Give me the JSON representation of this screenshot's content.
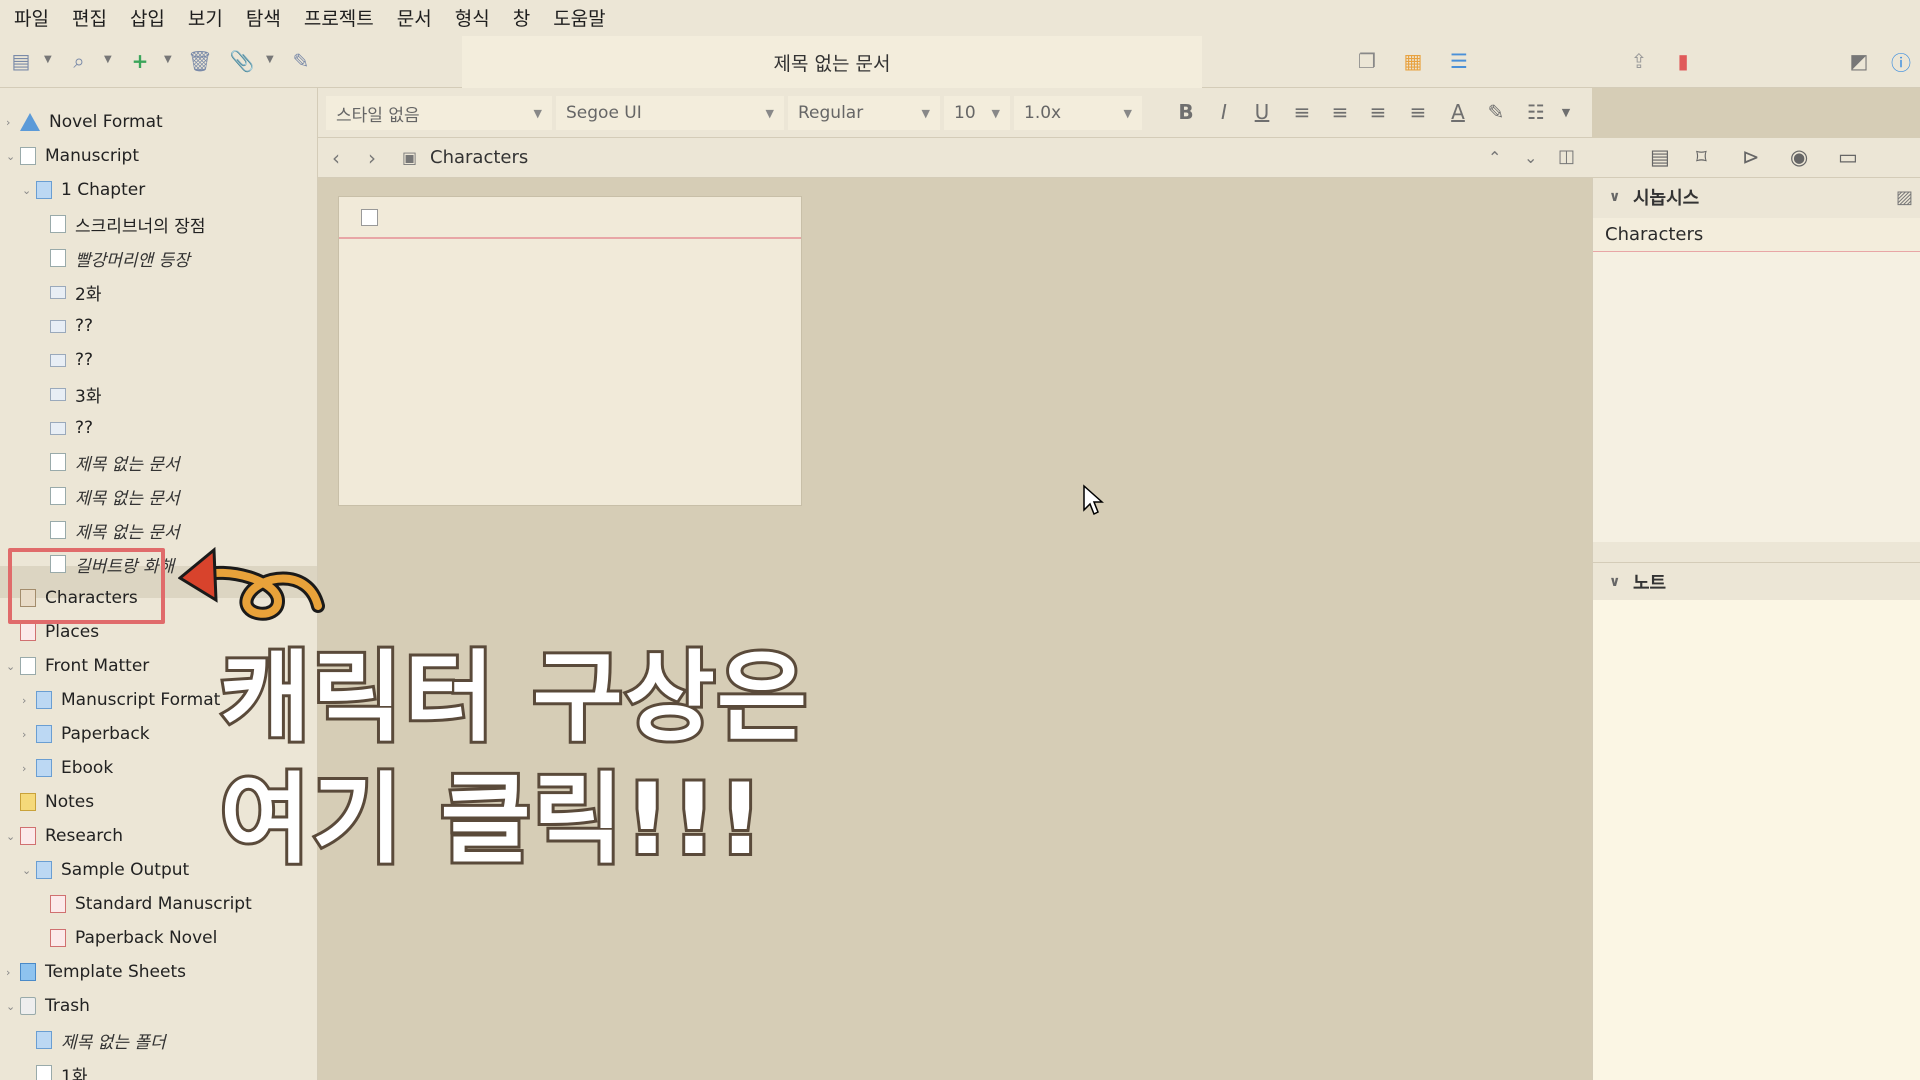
{
  "menu": [
    "파일",
    "편집",
    "삽입",
    "보기",
    "탐색",
    "프로젝트",
    "문서",
    "형식",
    "창",
    "도움말"
  ],
  "document_title": "제목 없는 문서",
  "binder": [
    {
      "label": "Novel Format",
      "icon": "warning-icon",
      "italic": false
    },
    {
      "label": "Manuscript",
      "icon": "doc-icon",
      "italic": false
    },
    {
      "label": "1 Chapter",
      "icon": "folder-icon",
      "italic": false
    },
    {
      "label": "스크리브너의 장점",
      "icon": "doc-icon",
      "italic": false
    },
    {
      "label": "빨강머리앤 등장",
      "icon": "doc-icon",
      "italic": true
    },
    {
      "label": "2화",
      "icon": "scene-icon",
      "italic": false
    },
    {
      "label": "??",
      "icon": "scene-icon",
      "italic": false
    },
    {
      "label": "??",
      "icon": "scene-icon",
      "italic": false
    },
    {
      "label": "3화",
      "icon": "scene-icon",
      "italic": false
    },
    {
      "label": "??",
      "icon": "scene-icon",
      "italic": false
    },
    {
      "label": "제목 없는 문서",
      "icon": "doc-icon",
      "italic": true
    },
    {
      "label": "제목 없는 문서",
      "icon": "doc-icon",
      "italic": true
    },
    {
      "label": "제목 없는 문서",
      "icon": "doc-icon",
      "italic": true
    },
    {
      "label": "길버트랑 화해",
      "icon": "doc-icon",
      "italic": true
    },
    {
      "label": "Characters",
      "icon": "character-icon",
      "italic": false
    },
    {
      "label": "Places",
      "icon": "places-icon",
      "italic": false
    },
    {
      "label": "Front Matter",
      "icon": "doc-icon",
      "italic": false
    },
    {
      "label": "Manuscript Format",
      "icon": "folder-icon",
      "italic": false
    },
    {
      "label": "Paperback",
      "icon": "folder-icon",
      "italic": false
    },
    {
      "label": "Ebook",
      "icon": "folder-icon",
      "italic": false
    },
    {
      "label": "Notes",
      "icon": "notebook-icon",
      "italic": false
    },
    {
      "label": "Research",
      "icon": "research-icon",
      "italic": false
    },
    {
      "label": "Sample Output",
      "icon": "folder-icon",
      "italic": false
    },
    {
      "label": "Standard Manuscript",
      "icon": "pdf-icon",
      "italic": false
    },
    {
      "label": "Paperback Novel",
      "icon": "pdf-icon",
      "italic": false
    },
    {
      "label": "Template Sheets",
      "icon": "template-icon",
      "italic": false
    },
    {
      "label": "Trash",
      "icon": "trash-icon",
      "italic": false
    },
    {
      "label": "제목 없는 폴더",
      "icon": "folder-icon",
      "italic": true
    },
    {
      "label": "1화",
      "icon": "doc-icon",
      "italic": false
    }
  ],
  "format": {
    "style": "스타일 없음",
    "font": "Segoe UI",
    "weight": "Regular",
    "size": "10",
    "spacing": "1.0x"
  },
  "nav": {
    "title": "Characters"
  },
  "inspector": {
    "synopsis_header": "시놉시스",
    "synopsis_title": "Characters",
    "notes_header": "노트"
  },
  "overlay": {
    "line1": "캐릭터 구상은",
    "line2": "여기 클릭!!!"
  }
}
